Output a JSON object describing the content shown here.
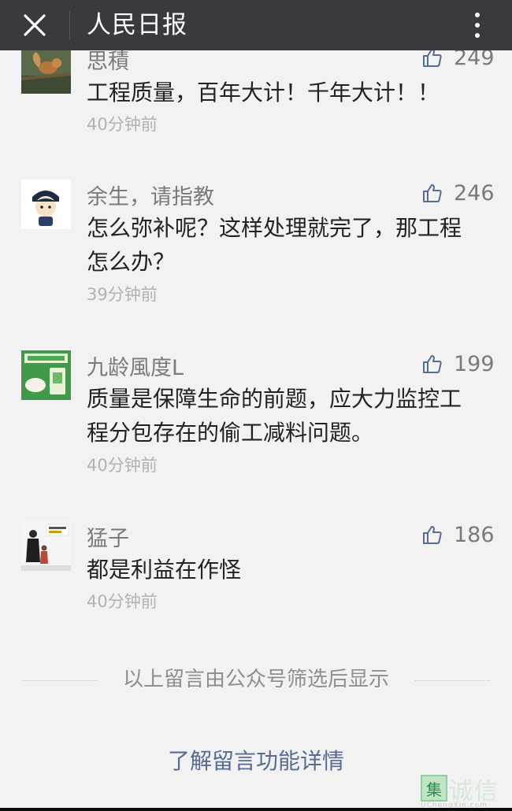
{
  "header": {
    "title": "人民日报",
    "close_icon": "close-icon",
    "more_icon": "more-vertical-icon"
  },
  "comments": [
    {
      "nickname": "思積",
      "likes": "249",
      "content": "工程质量，百年大计！千年大计！！",
      "time": "40分钟前",
      "avatar_icon": "squirrel-photo-avatar"
    },
    {
      "nickname": "余生，请指教",
      "likes": "246",
      "content": "怎么弥补呢？这样处理就完了，那工程怎么办？",
      "time": "39分钟前",
      "avatar_icon": "cartoon-character-avatar"
    },
    {
      "nickname": "九龄風度L",
      "likes": "199",
      "content": "质量是保障生命的前题，应大力监控工程分包存在的偷工减料问题。",
      "time": "40分钟前",
      "avatar_icon": "rice-package-avatar"
    },
    {
      "nickname": "猛子",
      "likes": "186",
      "content": "都是利益在作怪",
      "time": "40分钟前",
      "avatar_icon": "movie-poster-avatar"
    }
  ],
  "footer": {
    "filter_notice": "以上留言由公众号筛选后显示",
    "learn_more": "了解留言功能详情"
  },
  "watermark": {
    "badge": "集",
    "text": "诚信",
    "sub": "UChengXin.com"
  },
  "colors": {
    "header_bg": "#393a3e",
    "link": "#576b95",
    "page_bg": "#f2f2f2"
  }
}
